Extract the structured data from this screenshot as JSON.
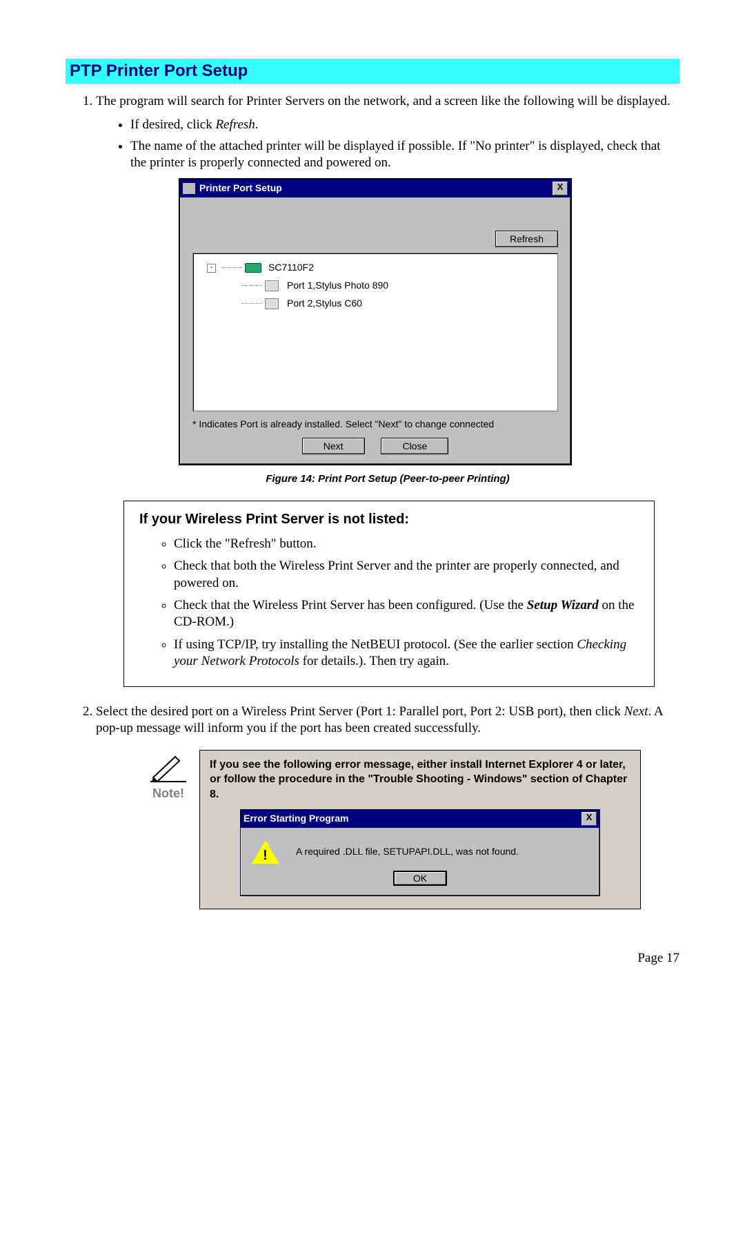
{
  "section_title": "PTP Printer Port Setup",
  "step1_intro": "The program will search for Printer Servers on the network, and a screen like the following will be displayed.",
  "step1_b1a": "If desired, click ",
  "step1_b1b_italic": "Refresh",
  "step1_b1c": ".",
  "step1_b2": "The name of the attached printer will be displayed if possible. If \"No printer\" is displayed, check that the printer is properly connected and powered on.",
  "dlg1": {
    "title": "Printer Port Setup",
    "close_x": "X",
    "refresh_btn": "Refresh",
    "device": "SC7110F2",
    "port1": "Port 1,Stylus Photo 890",
    "port2": "Port 2,Stylus C60",
    "hint": "* Indicates Port is already installed. Select \"Next\" to change connected",
    "next_btn": "Next",
    "close_btn": "Close"
  },
  "caption": "Figure 14: Print Port Setup (Peer-to-peer Printing)",
  "aside": {
    "title": "If your Wireless Print Server is not listed:",
    "b1": "Click the \"Refresh\" button.",
    "b2": "Check that both the Wireless Print Server and the printer are properly connected, and powered on.",
    "b3a": "Check that the Wireless Print Server has been configured. (Use the ",
    "b3b_bi": "Setup Wizard",
    "b3c": " on the CD-ROM.)",
    "b4a": "If using TCP/IP, try installing the NetBEUI protocol. (See the earlier section ",
    "b4b_italic": "Checking your Network Protocols",
    "b4c": " for details.). Then try again."
  },
  "step2a": "Select the desired port on a Wireless Print Server (Port 1: Parallel port, Port 2: USB port), then click ",
  "step2b_italic": "Next",
  "step2c": ". A pop-up message will inform you if the port has been created successfully.",
  "note_label": "Note!",
  "note_text": "If you see the following error message, either install Internet Explorer 4 or later, or follow the procedure in the \"Trouble Shooting - Windows\" section of Chapter 8.",
  "err": {
    "title": "Error Starting Program",
    "close_x": "X",
    "msg": "A required .DLL file, SETUPAPI.DLL, was not found.",
    "ok": "OK"
  },
  "page_num": "Page 17"
}
